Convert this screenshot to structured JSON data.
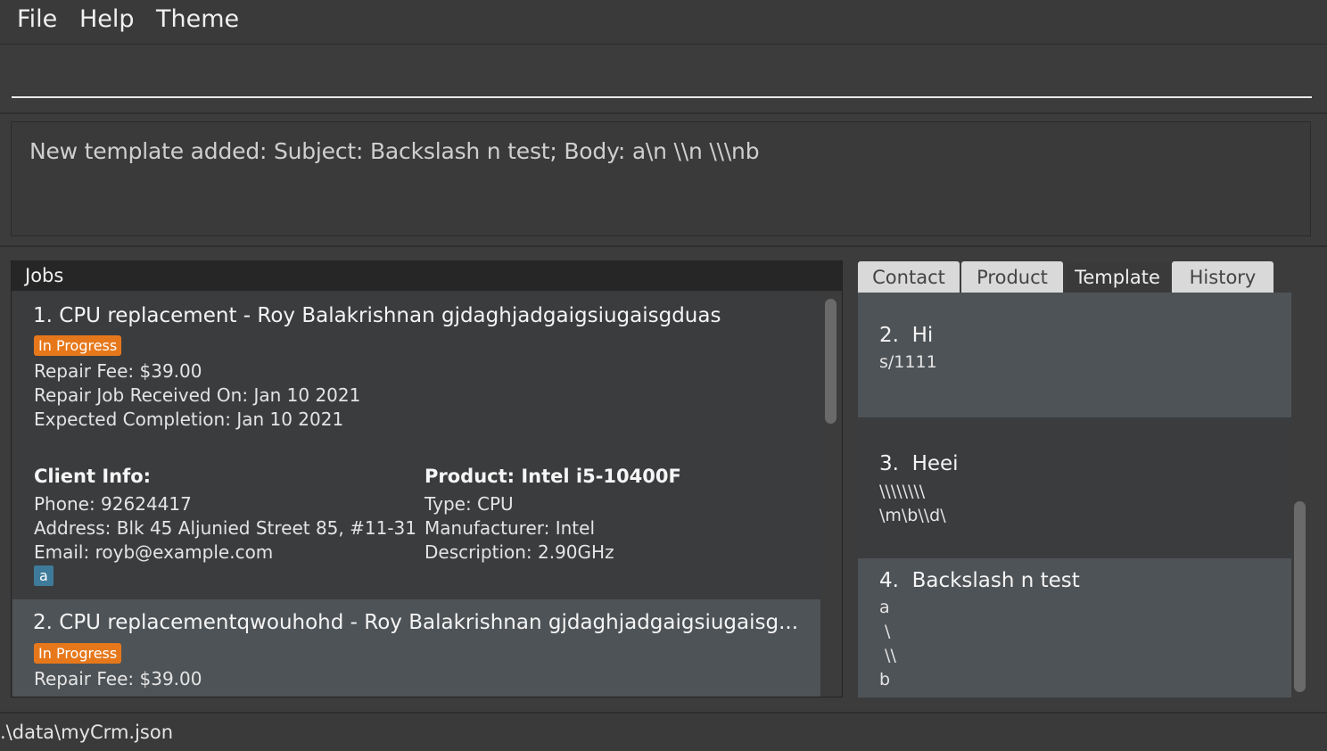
{
  "menu": {
    "file": "File",
    "help": "Help",
    "theme": "Theme"
  },
  "command_box": {
    "value": ""
  },
  "result": {
    "text": "New template added: Subject: Backslash n test; Body: a\\n \\\\n \\\\\\nb"
  },
  "jobs": {
    "title": "Jobs",
    "items": [
      {
        "title": "1. CPU replacement - Roy Balakrishnan gjdaghjadgaigsiugaisgduas",
        "status": "In Progress",
        "fee": "Repair Fee: $39.00",
        "received": "Repair Job Received On: Jan 10 2021",
        "expected": "Expected Completion: Jan 10 2021",
        "client_head": "Client Info:",
        "phone": "Phone: 92624417",
        "address": "Address: Blk 45 Aljunied Street 85, #11-31",
        "email": "Email: royb@example.com",
        "product_head": "Product: Intel i5-10400F",
        "type": "Type: CPU",
        "manufacturer": "Manufacturer: Intel",
        "description": "Description: 2.90GHz",
        "tag": "a"
      },
      {
        "title": "2. CPU replacementqwouhohd - Roy Balakrishnan gjdaghjadgaigsiugaisg...",
        "status": "In Progress",
        "fee": "Repair Fee: $39.00"
      }
    ]
  },
  "tabs": {
    "contact": "Contact",
    "product": "Product",
    "template": "Template",
    "history": "History",
    "active": "Template"
  },
  "templates": [
    {
      "title": "2.  Hi",
      "lines": [
        "s/1111"
      ]
    },
    {
      "title": "3.  Heei",
      "lines": [
        "\\\\\\\\\\\\\\\\",
        "\\m\\b\\\\d\\"
      ]
    },
    {
      "title": "4.  Backslash n test",
      "lines": [
        "a",
        " \\",
        " \\\\",
        "b"
      ]
    }
  ],
  "status_bar": {
    "path": ".\\data\\myCrm.json"
  },
  "colors": {
    "accent_progress": "#e6781b",
    "tag": "#3e7b9a",
    "selected_row": "#4e5357"
  }
}
